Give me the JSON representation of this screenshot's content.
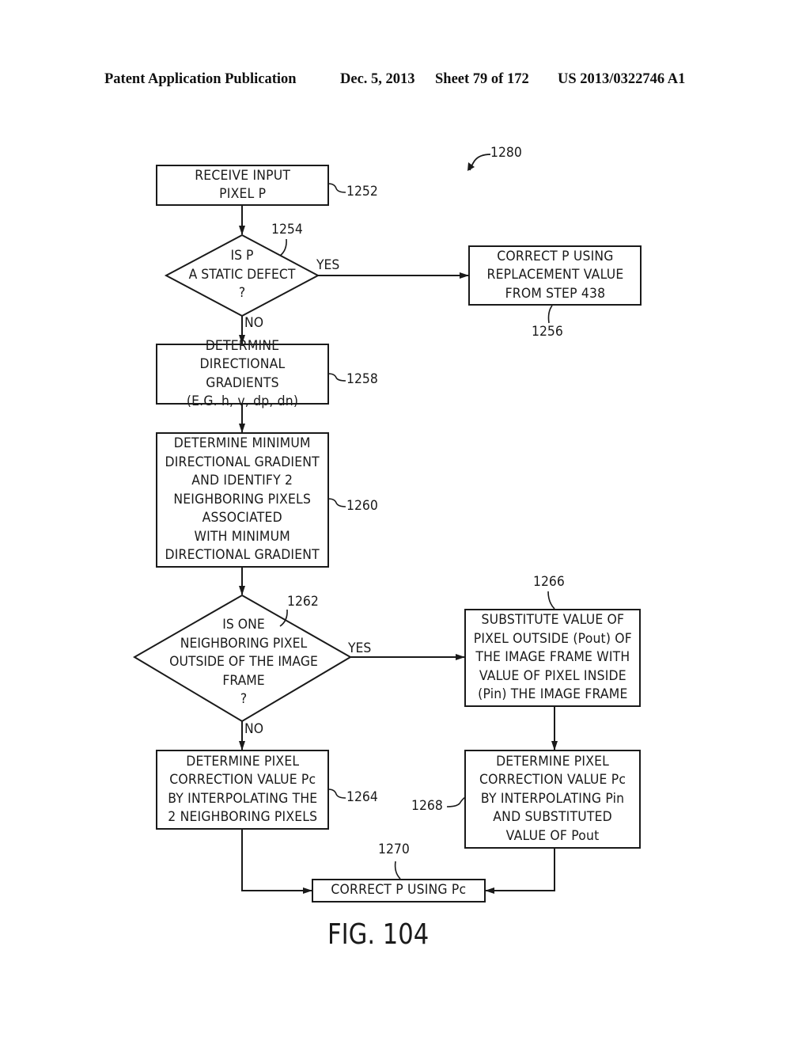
{
  "header": {
    "publication": "Patent Application Publication",
    "date": "Dec. 5, 2013",
    "sheet": "Sheet 79 of 172",
    "number": "US 2013/0322746 A1"
  },
  "figure": {
    "ref": "1280",
    "caption": "FIG. 104"
  },
  "nodes": {
    "n1252": {
      "ref": "1252",
      "type": "process",
      "text": "RECEIVE INPUT\nPIXEL P"
    },
    "n1254": {
      "ref": "1254",
      "type": "decision",
      "text": "IS P\nA STATIC DEFECT\n?"
    },
    "n1256": {
      "ref": "1256",
      "type": "process",
      "text": "CORRECT P USING\nREPLACEMENT VALUE\nFROM STEP 438"
    },
    "n1258": {
      "ref": "1258",
      "type": "process",
      "text": "DETERMINE\nDIRECTIONAL GRADIENTS\n(E.G. h, v, dp, dn)"
    },
    "n1260": {
      "ref": "1260",
      "type": "process",
      "text": "DETERMINE MINIMUM\nDIRECTIONAL GRADIENT\nAND IDENTIFY 2\nNEIGHBORING PIXELS\nASSOCIATED\nWITH MINIMUM\nDIRECTIONAL GRADIENT"
    },
    "n1262": {
      "ref": "1262",
      "type": "decision",
      "text": "IS ONE\nNEIGHBORING PIXEL\nOUTSIDE OF THE IMAGE\nFRAME\n?"
    },
    "n1264": {
      "ref": "1264",
      "type": "process",
      "text": "DETERMINE PIXEL\nCORRECTION VALUE Pc\nBY INTERPOLATING THE\n2 NEIGHBORING PIXELS"
    },
    "n1266": {
      "ref": "1266",
      "type": "process",
      "text": "SUBSTITUTE VALUE OF\nPIXEL OUTSIDE (Pout) OF\nTHE IMAGE FRAME WITH\nVALUE OF PIXEL INSIDE\n(Pin) THE IMAGE FRAME"
    },
    "n1268": {
      "ref": "1268",
      "type": "process",
      "text": "DETERMINE PIXEL\nCORRECTION VALUE Pc\nBY INTERPOLATING Pin\nAND SUBSTITUTED\nVALUE OF Pout"
    },
    "n1270": {
      "ref": "1270",
      "type": "process",
      "text": "CORRECT P USING Pc"
    }
  },
  "edges": [
    {
      "from": "1252",
      "to": "1254",
      "label": ""
    },
    {
      "from": "1254",
      "to": "1256",
      "label": "YES"
    },
    {
      "from": "1254",
      "to": "1258",
      "label": "NO"
    },
    {
      "from": "1258",
      "to": "1260",
      "label": ""
    },
    {
      "from": "1260",
      "to": "1262",
      "label": ""
    },
    {
      "from": "1262",
      "to": "1266",
      "label": "YES"
    },
    {
      "from": "1262",
      "to": "1264",
      "label": "NO"
    },
    {
      "from": "1266",
      "to": "1268",
      "label": ""
    },
    {
      "from": "1264",
      "to": "1270",
      "label": ""
    },
    {
      "from": "1268",
      "to": "1270",
      "label": ""
    }
  ]
}
